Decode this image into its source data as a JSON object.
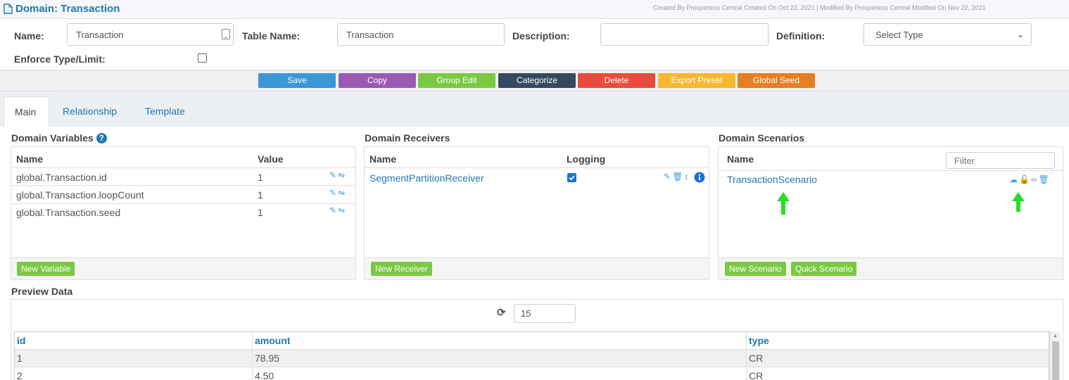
{
  "window": {
    "title": "Domain: Transaction",
    "meta": "Created By Prosperless Central Created On Oct 22, 2021 | Modified By Prosperless Central Modified On Nov 22, 2021"
  },
  "form": {
    "name_label": "Name:",
    "name_value": "Transaction",
    "table_name_label": "Table Name:",
    "table_name_value": "Transaction",
    "description_label": "Description:",
    "description_value": "",
    "definition_label": "Definition:",
    "definition_value": "Select Type",
    "enforce_label": "Enforce Type/Limit:"
  },
  "toolbar": {
    "save": "Save",
    "copy": "Copy",
    "group_edit": "Group Edit",
    "categorize": "Categorize",
    "delete": "Delete",
    "export_preset": "Export Preset",
    "global_seed": "Global Seed"
  },
  "colors": {
    "save": "#3a97d8",
    "copy": "#9b59b6",
    "group_edit": "#7ac943",
    "categorize": "#34495e",
    "delete": "#e74c3c",
    "export_preset": "#f7b731",
    "global_seed": "#e67e22",
    "annotation_arrow": "#22e022"
  },
  "tabs": [
    "Main",
    "Relationship",
    "Template"
  ],
  "variables": {
    "title": "Domain Variables",
    "help_icon": "question-circle-icon",
    "col_name": "Name",
    "col_value": "Value",
    "rows": [
      {
        "name": "global.Transaction.id",
        "value": "1"
      },
      {
        "name": "global.Transaction.loopCount",
        "value": "1"
      },
      {
        "name": "global.Transaction.seed",
        "value": "1"
      }
    ],
    "new_button": "New Variable"
  },
  "receivers": {
    "title": "Domain Receivers",
    "col_name": "Name",
    "col_logging": "Logging",
    "rows": [
      {
        "name": "SegmentPartitionReceiver",
        "logging": true
      }
    ],
    "new_button": "New Receiver"
  },
  "scenarios": {
    "title": "Domain Scenarios",
    "col_name": "Name",
    "filter_placeholder": "Filter",
    "rows": [
      {
        "name": "TransactionScenario"
      }
    ],
    "new_button": "New Scenario",
    "quick_button": "Quick Scenario"
  },
  "preview": {
    "title": "Preview Data",
    "count": "15",
    "columns": [
      "id",
      "amount",
      "type"
    ],
    "rows": [
      [
        "1",
        "78.95",
        "CR"
      ],
      [
        "2",
        "4.50",
        "CR"
      ]
    ]
  }
}
